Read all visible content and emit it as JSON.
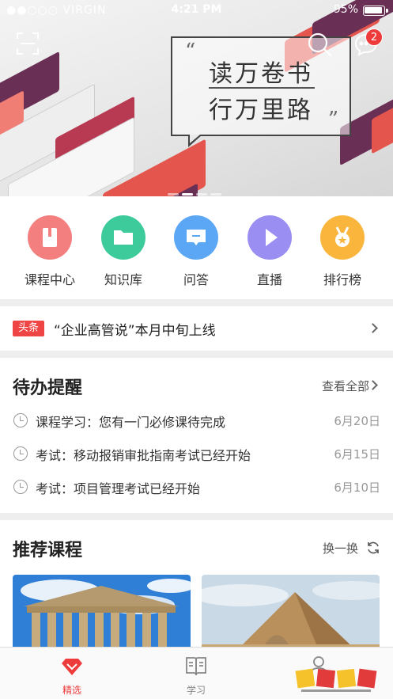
{
  "status_bar": {
    "carrier": "●●○○○ VIRGIN",
    "time": "4:21 PM",
    "battery": "95%"
  },
  "banner": {
    "line1": "读万卷书",
    "line2": "行万里路",
    "open_quote": "“",
    "close_quote": "”",
    "message_badge": "2",
    "slides": 4,
    "active_slide": 2
  },
  "categories": [
    {
      "label": "课程中心",
      "icon": "book-icon",
      "color": "#f47f7f"
    },
    {
      "label": "知识库",
      "icon": "folder-icon",
      "color": "#3ecb9c"
    },
    {
      "label": "问答",
      "icon": "chat-icon",
      "color": "#5ba7f5"
    },
    {
      "label": "直播",
      "icon": "play-icon",
      "color": "#9a8ef2"
    },
    {
      "label": "排行榜",
      "icon": "medal-icon",
      "color": "#f9b53c"
    }
  ],
  "headline": {
    "tag": "头条",
    "text": "“企业高管说”本月中旬上线"
  },
  "todo": {
    "title": "待办提醒",
    "view_all": "查看全部",
    "items": [
      {
        "text": "课程学习：您有一门必修课待完成",
        "date": "6月20日"
      },
      {
        "text": "考试：移动报销审批指南考试已经开始",
        "date": "6月15日"
      },
      {
        "text": "考试：项目管理考试已经开始",
        "date": "6月10日"
      }
    ]
  },
  "recommend": {
    "title": "推荐课程",
    "refresh": "换一换"
  },
  "tabs": [
    {
      "label": "精选",
      "icon": "gem-icon",
      "active": true
    },
    {
      "label": "学习",
      "icon": "open-book-icon",
      "active": false
    },
    {
      "label": "",
      "icon": "profile-icon",
      "active": false
    }
  ],
  "colors": {
    "accent": "#ee3b3b",
    "background": "#eeeeee"
  }
}
